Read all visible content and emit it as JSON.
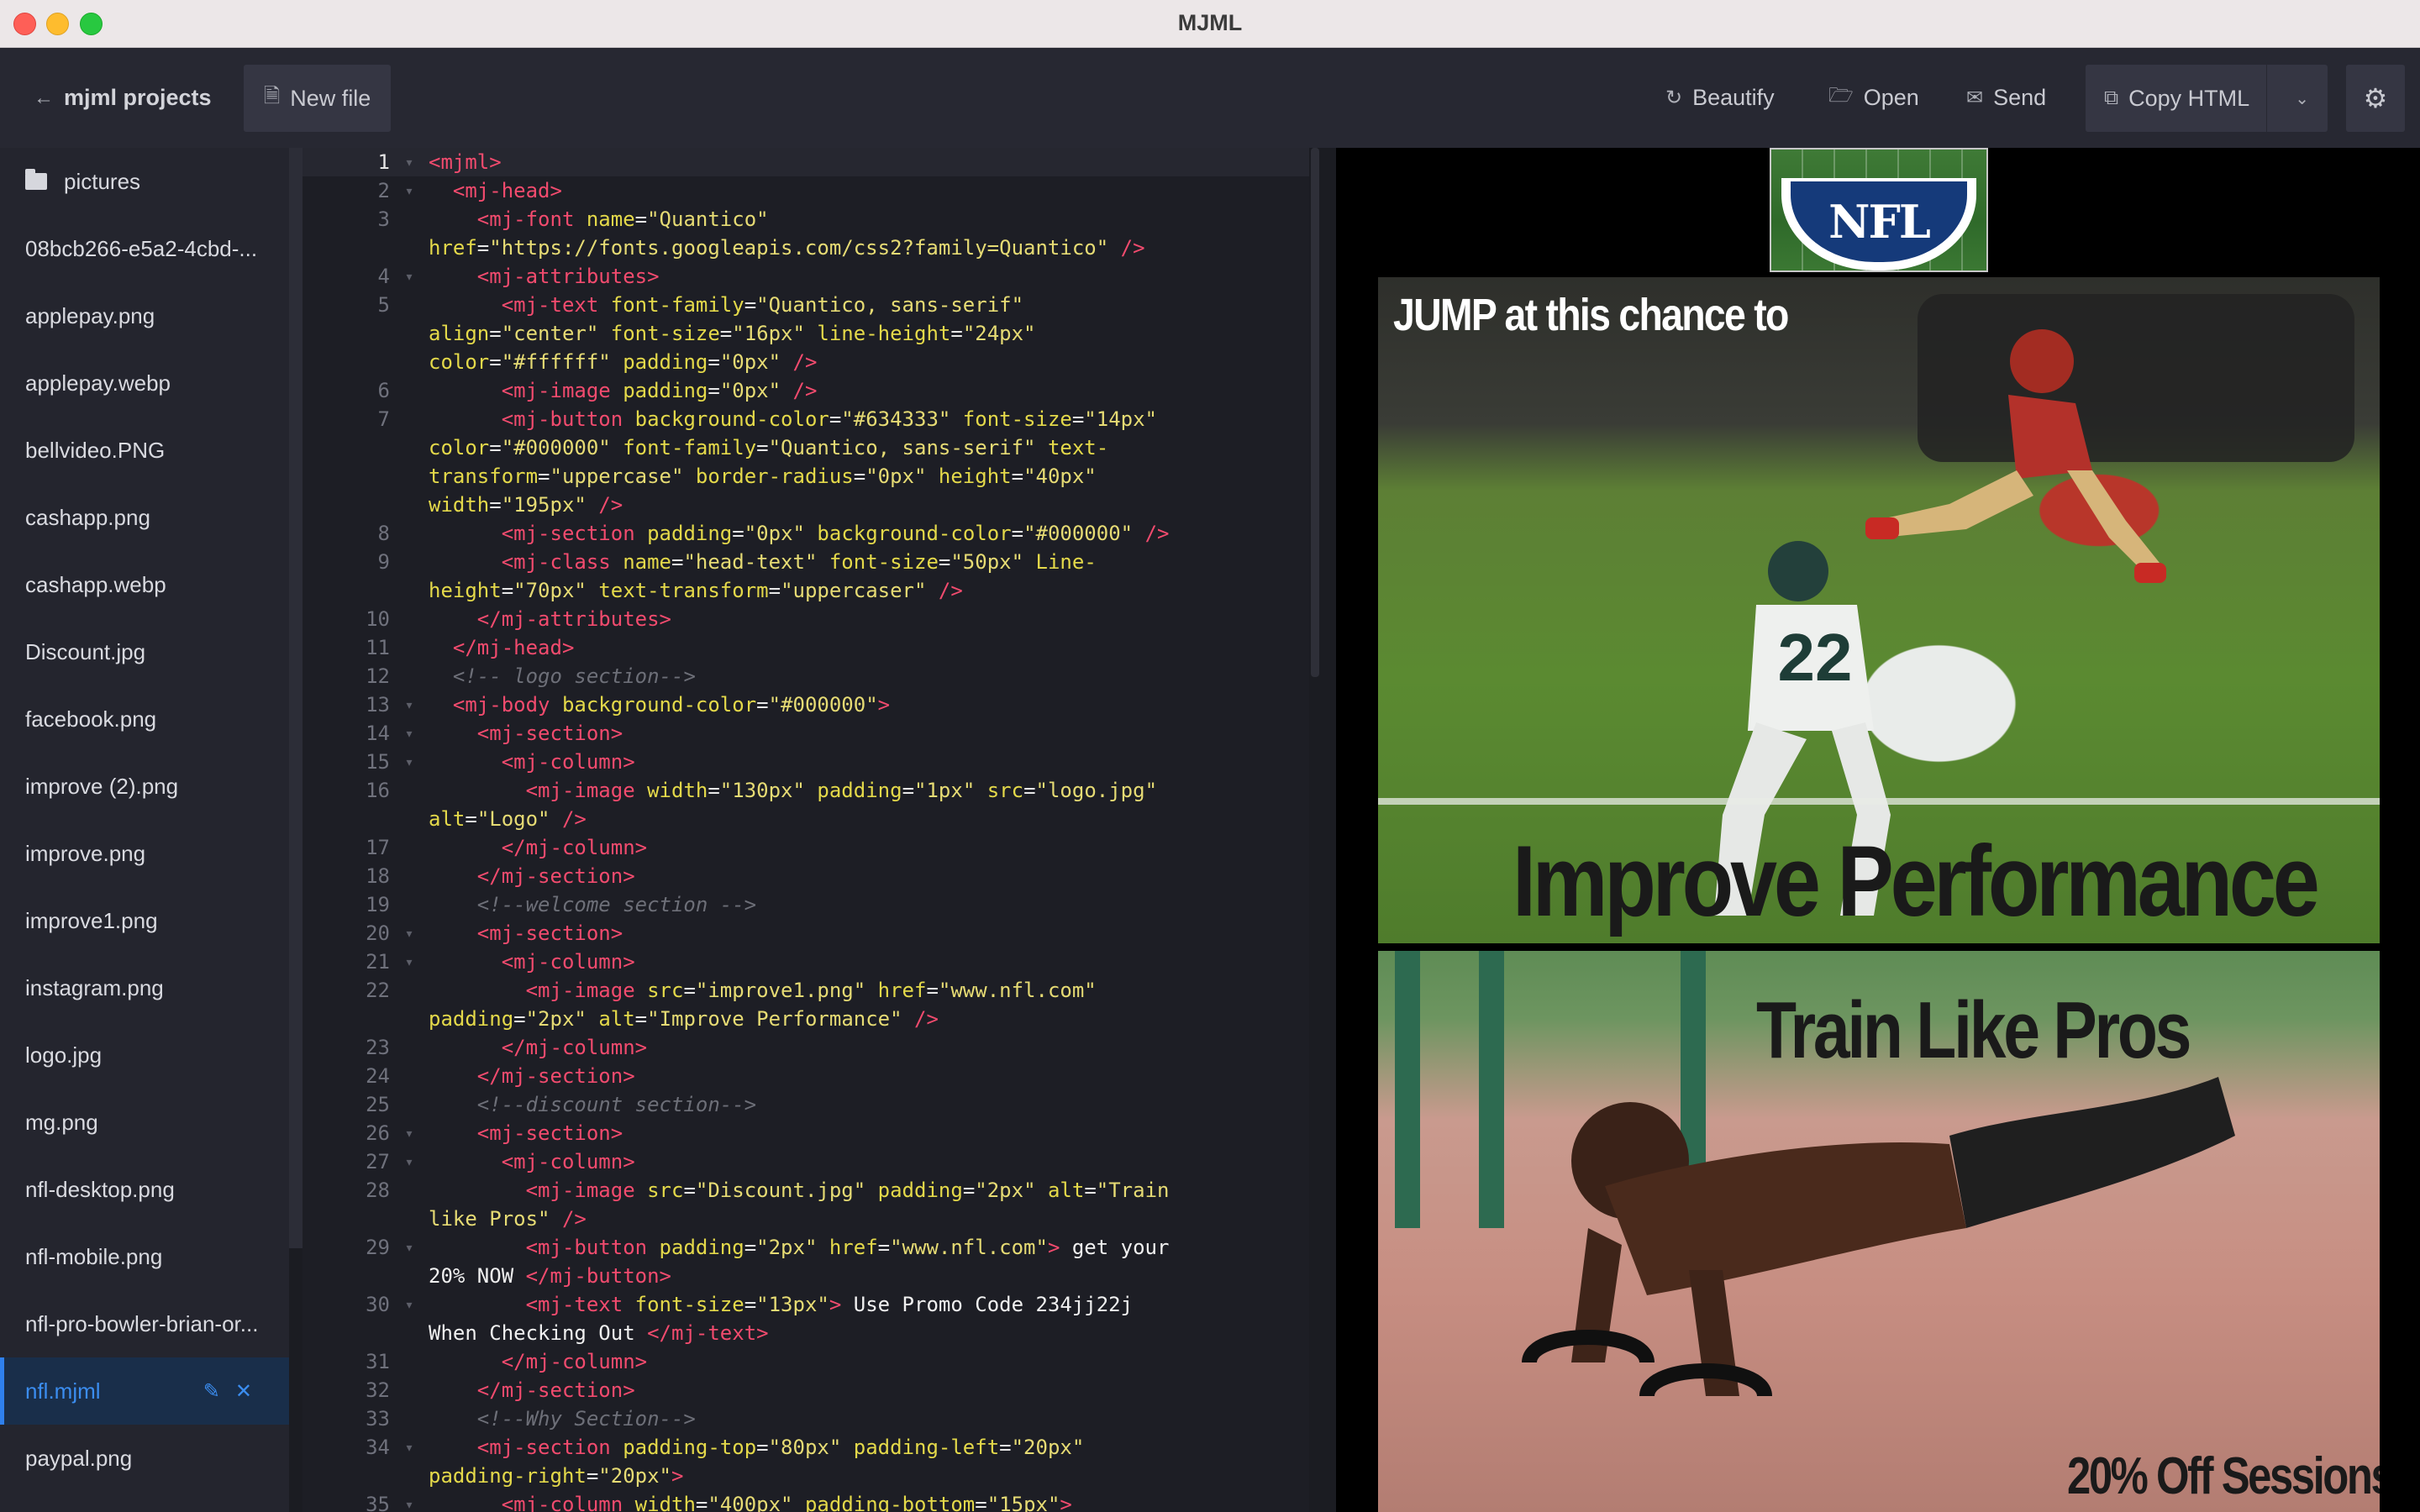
{
  "window": {
    "title": "MJML"
  },
  "toolbar": {
    "back_label": "mjml projects",
    "new_file_label": "New file",
    "beautify_label": "Beautify",
    "open_label": "Open",
    "send_label": "Send",
    "copy_html_label": "Copy HTML"
  },
  "sidebar": {
    "items": [
      {
        "label": "pictures",
        "type": "folder"
      },
      {
        "label": "08bcb266-e5a2-4cbd-..."
      },
      {
        "label": "applepay.png"
      },
      {
        "label": "applepay.webp"
      },
      {
        "label": "bellvideo.PNG"
      },
      {
        "label": "cashapp.png"
      },
      {
        "label": "cashapp.webp"
      },
      {
        "label": "Discount.jpg"
      },
      {
        "label": "facebook.png"
      },
      {
        "label": "improve (2).png"
      },
      {
        "label": "improve.png"
      },
      {
        "label": "improve1.png"
      },
      {
        "label": "instagram.png"
      },
      {
        "label": "logo.jpg"
      },
      {
        "label": "mg.png"
      },
      {
        "label": "nfl-desktop.png"
      },
      {
        "label": "nfl-mobile.png"
      },
      {
        "label": "nfl-pro-bowler-brian-or..."
      },
      {
        "label": "nfl.mjml",
        "active": true
      },
      {
        "label": "paypal.png"
      }
    ]
  },
  "editor": {
    "lines": [
      {
        "n": "1",
        "fold": true,
        "html": "<span class='tag'>&lt;mjml&gt;</span>"
      },
      {
        "n": "2",
        "fold": true,
        "html": "  <span class='tag'>&lt;mj-head&gt;</span>"
      },
      {
        "n": "3",
        "fold": false,
        "html": "    <span class='tag'>&lt;mj-font</span> <span class='attr'>name</span>=<span class='str'>\"Quantico\"</span>\n<span class='attr'>href</span>=<span class='str'>\"https://fonts.googleapis.com/css2?family=Quantico\"</span> <span class='tag'>/&gt;</span>"
      },
      {
        "n": "4",
        "fold": true,
        "html": "    <span class='tag'>&lt;mj-attributes&gt;</span>"
      },
      {
        "n": "5",
        "fold": false,
        "html": "      <span class='tag'>&lt;mj-text</span> <span class='attr'>font-family</span>=<span class='str'>\"Quantico, sans-serif\"</span>\n<span class='attr'>align</span>=<span class='str'>\"center\"</span> <span class='attr'>font-size</span>=<span class='str'>\"16px\"</span> <span class='attr'>line-height</span>=<span class='str'>\"24px\"</span>\n<span class='attr'>color</span>=<span class='str'>\"#ffffff\"</span> <span class='attr'>padding</span>=<span class='str'>\"0px\"</span> <span class='tag'>/&gt;</span>"
      },
      {
        "n": "6",
        "fold": false,
        "html": "      <span class='tag'>&lt;mj-image</span> <span class='attr'>padding</span>=<span class='str'>\"0px\"</span> <span class='tag'>/&gt;</span>"
      },
      {
        "n": "7",
        "fold": false,
        "html": "      <span class='tag'>&lt;mj-button</span> <span class='attr'>background-color</span>=<span class='str'>\"#634333\"</span> <span class='attr'>font-size</span>=<span class='str'>\"14px\"</span>\n<span class='attr'>color</span>=<span class='str'>\"#000000\"</span> <span class='attr'>font-family</span>=<span class='str'>\"Quantico, sans-serif\"</span> <span class='attr'>text-</span>\n<span class='attr'>transform</span>=<span class='str'>\"uppercase\"</span> <span class='attr'>border-radius</span>=<span class='str'>\"0px\"</span> <span class='attr'>height</span>=<span class='str'>\"40px\"</span>\n<span class='attr'>width</span>=<span class='str'>\"195px\"</span> <span class='tag'>/&gt;</span>"
      },
      {
        "n": "8",
        "fold": false,
        "html": "      <span class='tag'>&lt;mj-section</span> <span class='attr'>padding</span>=<span class='str'>\"0px\"</span> <span class='attr'>background-color</span>=<span class='str'>\"#000000\"</span> <span class='tag'>/&gt;</span>"
      },
      {
        "n": "9",
        "fold": false,
        "html": "      <span class='tag'>&lt;mj-class</span> <span class='attr'>name</span>=<span class='str'>\"head-text\"</span> <span class='attr'>font-size</span>=<span class='str'>\"50px\"</span> <span class='attr'>Line-</span>\n<span class='attr'>height</span>=<span class='str'>\"70px\"</span> <span class='attr'>text-transform</span>=<span class='str'>\"uppercaser\"</span> <span class='tag'>/&gt;</span>"
      },
      {
        "n": "10",
        "fold": false,
        "html": "    <span class='tag'>&lt;/mj-attributes&gt;</span>"
      },
      {
        "n": "11",
        "fold": false,
        "html": "  <span class='tag'>&lt;/mj-head&gt;</span>"
      },
      {
        "n": "12",
        "fold": false,
        "html": "  <span class='cmt'>&lt;!-- logo section--&gt;</span>"
      },
      {
        "n": "13",
        "fold": true,
        "html": "  <span class='tag'>&lt;mj-body</span> <span class='attr'>background-color</span>=<span class='str'>\"#000000\"</span><span class='tag'>&gt;</span>"
      },
      {
        "n": "14",
        "fold": true,
        "html": "    <span class='tag'>&lt;mj-section&gt;</span>"
      },
      {
        "n": "15",
        "fold": true,
        "html": "      <span class='tag'>&lt;mj-column&gt;</span>"
      },
      {
        "n": "16",
        "fold": false,
        "html": "        <span class='tag'>&lt;mj-image</span> <span class='attr'>width</span>=<span class='str'>\"130px\"</span> <span class='attr'>padding</span>=<span class='str'>\"1px\"</span> <span class='attr'>src</span>=<span class='str'>\"logo.jpg\"</span>\n<span class='attr'>alt</span>=<span class='str'>\"Logo\"</span> <span class='tag'>/&gt;</span>"
      },
      {
        "n": "17",
        "fold": false,
        "html": "      <span class='tag'>&lt;/mj-column&gt;</span>"
      },
      {
        "n": "18",
        "fold": false,
        "html": "    <span class='tag'>&lt;/mj-section&gt;</span>"
      },
      {
        "n": "19",
        "fold": false,
        "html": "    <span class='cmt'>&lt;!--welcome section --&gt;</span>"
      },
      {
        "n": "20",
        "fold": true,
        "html": "    <span class='tag'>&lt;mj-section&gt;</span>"
      },
      {
        "n": "21",
        "fold": true,
        "html": "      <span class='tag'>&lt;mj-column&gt;</span>"
      },
      {
        "n": "22",
        "fold": false,
        "html": "        <span class='tag'>&lt;mj-image</span> <span class='attr'>src</span>=<span class='str'>\"improve1.png\"</span> <span class='attr'>href</span>=<span class='str'>\"www.nfl.com\"</span>\n<span class='attr'>padding</span>=<span class='str'>\"2px\"</span> <span class='attr'>alt</span>=<span class='str'>\"Improve Performance\"</span> <span class='tag'>/&gt;</span>"
      },
      {
        "n": "23",
        "fold": false,
        "html": "      <span class='tag'>&lt;/mj-column&gt;</span>"
      },
      {
        "n": "24",
        "fold": false,
        "html": "    <span class='tag'>&lt;/mj-section&gt;</span>"
      },
      {
        "n": "25",
        "fold": false,
        "html": "    <span class='cmt'>&lt;!--discount section--&gt;</span>"
      },
      {
        "n": "26",
        "fold": true,
        "html": "    <span class='tag'>&lt;mj-section&gt;</span>"
      },
      {
        "n": "27",
        "fold": true,
        "html": "      <span class='tag'>&lt;mj-column&gt;</span>"
      },
      {
        "n": "28",
        "fold": false,
        "html": "        <span class='tag'>&lt;mj-image</span> <span class='attr'>src</span>=<span class='str'>\"Discount.jpg\"</span> <span class='attr'>padding</span>=<span class='str'>\"2px\"</span> <span class='attr'>alt</span>=<span class='str'>\"Train\nlike Pros\"</span> <span class='tag'>/&gt;</span>"
      },
      {
        "n": "29",
        "fold": true,
        "html": "        <span class='tag'>&lt;mj-button</span> <span class='attr'>padding</span>=<span class='str'>\"2px\"</span> <span class='attr'>href</span>=<span class='str'>\"www.nfl.com\"</span><span class='tag'>&gt;</span><span class='txt'> get your\n20% NOW </span><span class='tag'>&lt;/mj-button&gt;</span>"
      },
      {
        "n": "30",
        "fold": true,
        "html": "        <span class='tag'>&lt;mj-text</span> <span class='attr'>font-size</span>=<span class='str'>\"13px\"</span><span class='tag'>&gt;</span><span class='txt'> Use Promo Code 234jj22j\nWhen Checking Out </span><span class='tag'>&lt;/mj-text&gt;</span>"
      },
      {
        "n": "31",
        "fold": false,
        "html": "      <span class='tag'>&lt;/mj-column&gt;</span>"
      },
      {
        "n": "32",
        "fold": false,
        "html": "    <span class='tag'>&lt;/mj-section&gt;</span>"
      },
      {
        "n": "33",
        "fold": false,
        "html": "    <span class='cmt'>&lt;!--Why Section--&gt;</span>"
      },
      {
        "n": "34",
        "fold": true,
        "html": "    <span class='tag'>&lt;mj-section</span> <span class='attr'>padding-top</span>=<span class='str'>\"80px\"</span> <span class='attr'>padding-left</span>=<span class='str'>\"20px\"</span>\n<span class='attr'>padding-right</span>=<span class='str'>\"20px\"</span><span class='tag'>&gt;</span>"
      },
      {
        "n": "35",
        "fold": true,
        "html": "      <span class='tag'>&lt;mj-column</span> <span class='attr'>width</span>=<span class='str'>\"400px\"</span> <span class='attr'>padding-bottom</span>=<span class='str'>\"15px\"</span><span class='tag'>&gt;</span>"
      }
    ]
  },
  "preview": {
    "logo_text": "NFL",
    "hero_small_text": "JUMP at this chance to",
    "hero_big_text": "Improve Performance",
    "train_text": "Train Like Pros",
    "discount_text": "20% Off Sessions"
  },
  "colors": {
    "accent": "#2f80ed",
    "tag": "#f24b6e",
    "string": "#e6db74"
  }
}
